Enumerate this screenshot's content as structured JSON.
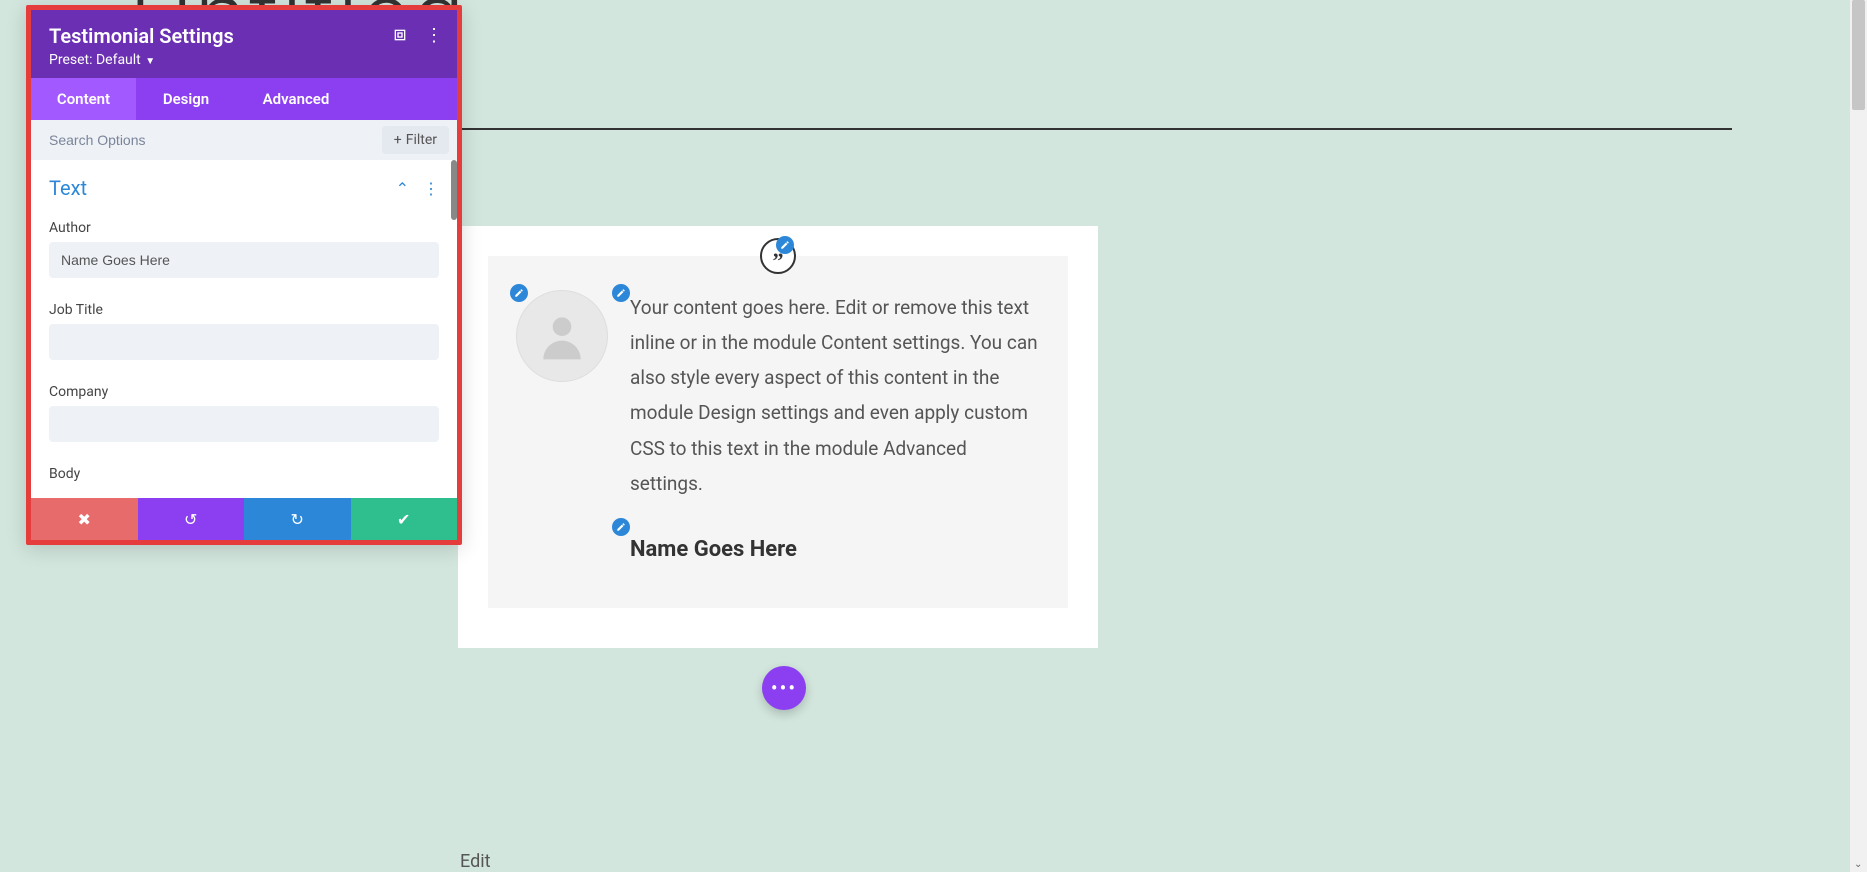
{
  "page": {
    "title": "Untitled",
    "edit_label": "Edit"
  },
  "panel": {
    "title": "Testimonial Settings",
    "preset": "Preset: Default",
    "tabs": {
      "content": "Content",
      "design": "Design",
      "advanced": "Advanced"
    },
    "search_placeholder": "Search Options",
    "filter_label": "Filter",
    "sections": {
      "text": {
        "title": "Text",
        "fields": {
          "author": {
            "label": "Author",
            "value": "Name Goes Here"
          },
          "job_title": {
            "label": "Job Title",
            "value": ""
          },
          "company": {
            "label": "Company",
            "value": ""
          },
          "body": {
            "label": "Body"
          }
        }
      }
    }
  },
  "testimonial": {
    "body": "Your content goes here. Edit or remove this text inline or in the module Content settings. You can also style every aspect of this content in the module Design settings and even apply custom CSS to this text in the module Advanced settings.",
    "author": "Name Goes Here"
  }
}
